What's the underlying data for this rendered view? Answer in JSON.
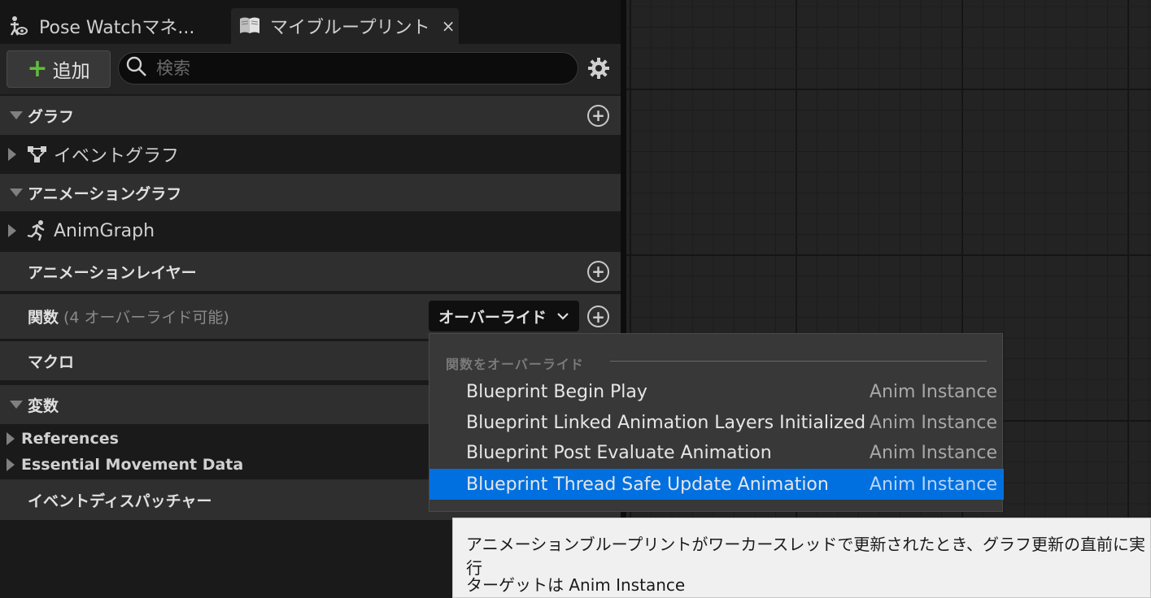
{
  "tabs": [
    {
      "label": "Pose Watchマネ...",
      "icon": "pose-watch-icon"
    },
    {
      "label": "マイブループリント",
      "icon": "blueprint-book-icon",
      "close": "×"
    }
  ],
  "toolbar": {
    "add_label": "追加",
    "add_icon": "plus-icon",
    "search_placeholder": "検索"
  },
  "sections": {
    "graph": {
      "label": "グラフ"
    },
    "event_graph": {
      "label": "イベントグラフ"
    },
    "anim_graph_header": {
      "label": "アニメーショングラフ"
    },
    "anim_graph": {
      "label": "AnimGraph"
    },
    "anim_layer": {
      "label": "アニメーションレイヤー"
    },
    "functions": {
      "label": "関数",
      "count": "(4 オーバーライド可能)",
      "override_label": "オーバーライド"
    },
    "macros": {
      "label": "マクロ"
    },
    "variables": {
      "label": "変数"
    },
    "references": {
      "label": "References"
    },
    "essential": {
      "label": "Essential Movement Data"
    },
    "dispatchers": {
      "label": "イベントディスパッチャー"
    }
  },
  "dropdown": {
    "header": "関数をオーバーライド",
    "items": [
      {
        "name": "Blueprint Begin Play",
        "target": "Anim Instance"
      },
      {
        "name": "Blueprint Linked Animation Layers Initialized",
        "target": "Anim Instance"
      },
      {
        "name": "Blueprint Post Evaluate Animation",
        "target": "Anim Instance"
      },
      {
        "name": "Blueprint Thread Safe Update Animation",
        "target": "Anim Instance",
        "selected": true
      }
    ]
  },
  "tooltip": {
    "line1": "アニメーションブループリントがワーカースレッドで更新されたとき、グラフ更新の直前に実行",
    "line2": "ターゲットは Anim Instance"
  },
  "colors": {
    "selection": "#0070e0",
    "add_plus": "#5fbf3a",
    "panel_bg": "#1a1a1a",
    "header_bg": "#2f2f2f",
    "graph_bg": "#232323"
  }
}
